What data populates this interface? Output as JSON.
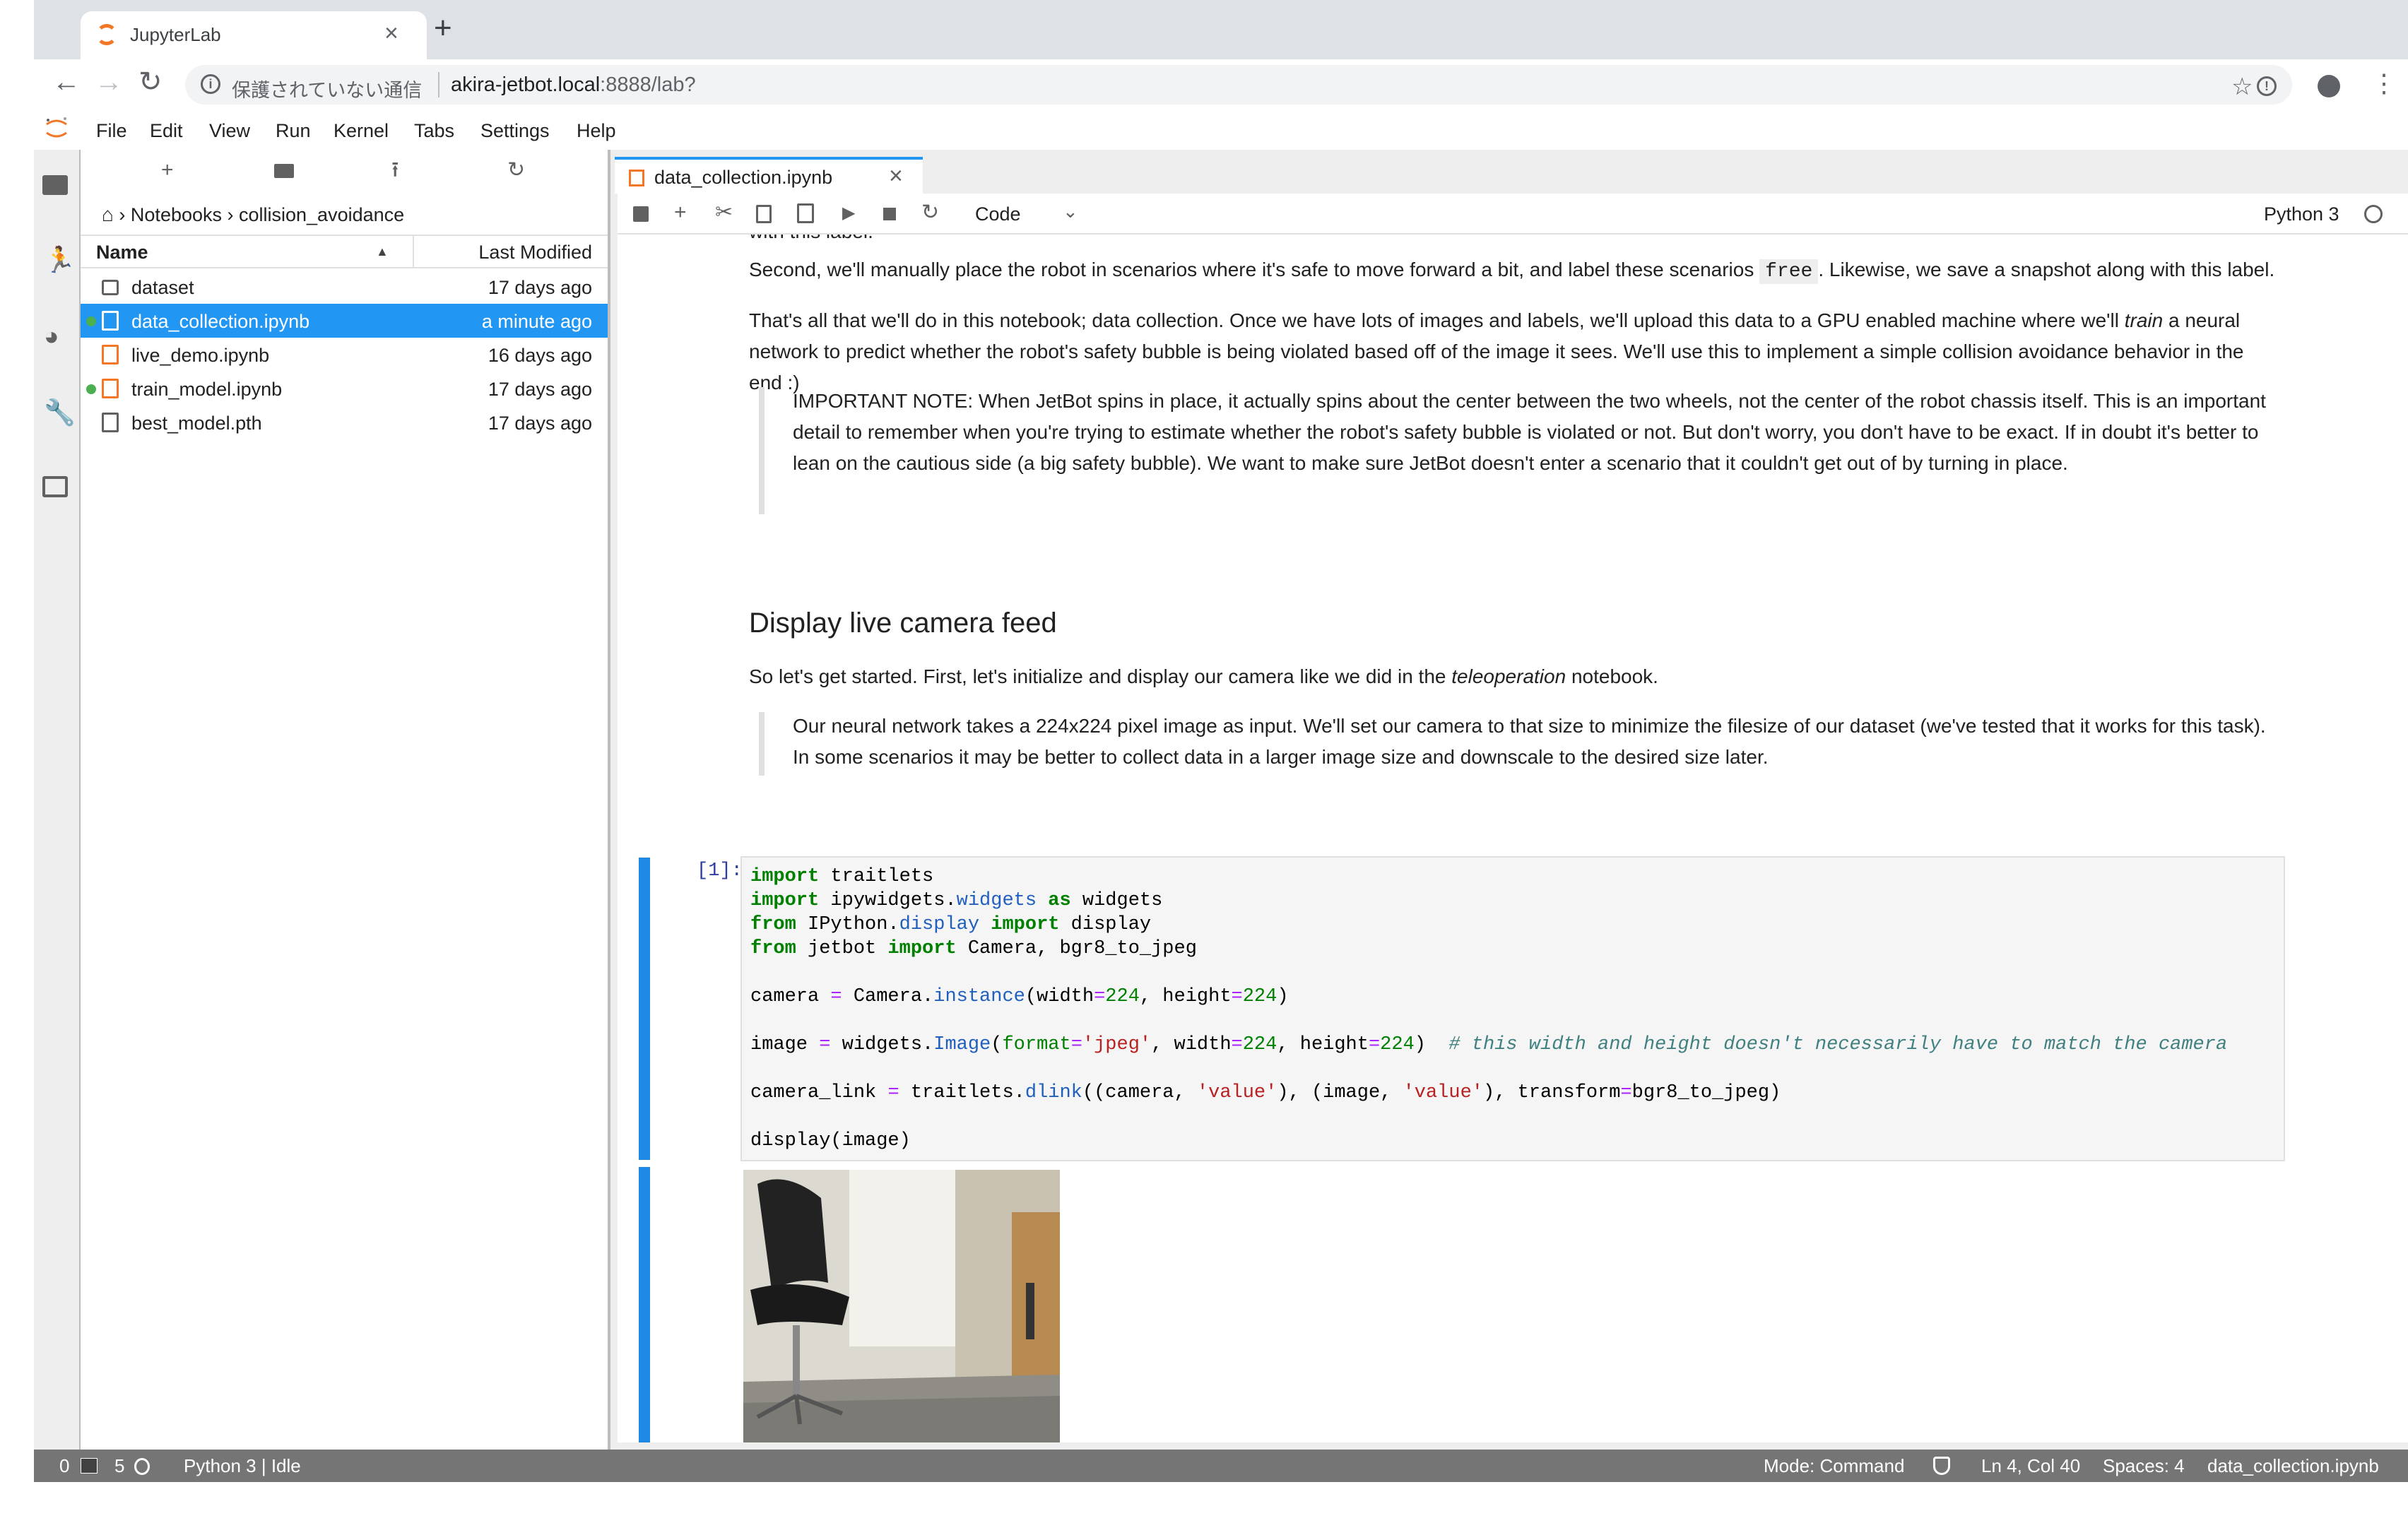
{
  "browser": {
    "tab_title": "JupyterLab",
    "security_text": "保護されていない通信",
    "url_host": "akira-jetbot.local",
    "url_path": ":8888/lab?"
  },
  "menubar": {
    "items": [
      "File",
      "Edit",
      "View",
      "Run",
      "Kernel",
      "Tabs",
      "Settings",
      "Help"
    ]
  },
  "filebrowser": {
    "breadcrumb": "Notebooks › collision_avoidance",
    "col_name": "Name",
    "col_modified": "Last Modified",
    "files": [
      {
        "name": "dataset",
        "modified": "17 days ago"
      },
      {
        "name": "data_collection.ipynb",
        "modified": "a minute ago"
      },
      {
        "name": "live_demo.ipynb",
        "modified": "16 days ago"
      },
      {
        "name": "train_model.ipynb",
        "modified": "17 days ago"
      },
      {
        "name": "best_model.pth",
        "modified": "17 days ago"
      }
    ]
  },
  "notebook": {
    "tab_title": "data_collection.ipynb",
    "cell_type": "Code",
    "kernel": "Python 3",
    "md": {
      "p0": "with this label.",
      "p1_a": "Second, we'll manually place the robot in scenarios where it's safe to move forward a bit, and label these scenarios ",
      "p1_code": "free",
      "p1_b": ". Likewise, we save a snapshot along with this label.",
      "p2_a": "That's all that we'll do in this notebook; data collection. Once we have lots of images and labels, we'll upload this data to a GPU enabled machine where we'll ",
      "p2_em": "train",
      "p2_b": " a neural network to predict whether the robot's safety bubble is being violated based off of the image it sees. We'll use this to implement a simple collision avoidance behavior in the end :)",
      "note1": "IMPORTANT NOTE: When JetBot spins in place, it actually spins about the center between the two wheels, not the center of the robot chassis itself. This is an important detail to remember when you're trying to estimate whether the robot's safety bubble is violated or not. But don't worry, you don't have to be exact. If in doubt it's better to lean on the cautious side (a big safety bubble). We want to make sure JetBot doesn't enter a scenario that it couldn't get out of by turning in place.",
      "h2": "Display live camera feed",
      "p3_a": "So let's get started. First, let's initialize and display our camera like we did in the ",
      "p3_em": "teleoperation",
      "p3_b": " notebook.",
      "note2": "Our neural network takes a 224x224 pixel image as input. We'll set our camera to that size to minimize the filesize of our dataset (we've tested that it works for this task). In some scenarios it may be better to collect data in a larger image size and downscale to the desired size later."
    },
    "cell_prompt": "[1]:",
    "code": {
      "l1_kw": "import",
      "l1": " traitlets",
      "l2_kw": "import",
      "l2_a": " ipywidgets.",
      "l2_attr": "widgets",
      "l2_kw2": " as",
      "l2_b": " widgets",
      "l3_kw": "from",
      "l3_a": " IPython.",
      "l3_attr": "display",
      "l3_kw2": " import",
      "l3_b": " display",
      "l4_kw": "from",
      "l4_a": " jetbot",
      "l4_kw2": " import",
      "l4_b": " Camera, bgr8_to_jpeg",
      "l5_a": "camera ",
      "l5_op": "=",
      "l5_b": " Camera.",
      "l5_attr": "instance",
      "l5_c": "(width",
      "l5_op2": "=",
      "l5_n1": "224",
      "l5_d": ", height",
      "l5_op3": "=",
      "l5_n2": "224",
      "l5_e": ")",
      "l6_a": "image ",
      "l6_op": "=",
      "l6_b": " widgets.",
      "l6_attr": "Image",
      "l6_c": "(",
      "l6_fmt": "format",
      "l6_op2": "=",
      "l6_s": "'jpeg'",
      "l6_d": ", width",
      "l6_op3": "=",
      "l6_n1": "224",
      "l6_e": ", height",
      "l6_op4": "=",
      "l6_n2": "224",
      "l6_f": ")  ",
      "l6_com": "# this width and height doesn't necessarily have to match the camera",
      "l7_a": "camera_link ",
      "l7_op": "=",
      "l7_b": " traitlets.",
      "l7_attr": "dlink",
      "l7_c": "((camera, ",
      "l7_s1": "'value'",
      "l7_d": "), (image, ",
      "l7_s2": "'value'",
      "l7_e": "), transform",
      "l7_op2": "=",
      "l7_f": "bgr8_to_jpeg)",
      "l8": "display(image)"
    }
  },
  "statusbar": {
    "terminals": "0",
    "kernels": "5",
    "kernel_status": "Python 3 | Idle",
    "mode": "Mode: Command",
    "position": "Ln 4, Col 40",
    "spaces": "Spaces: 4",
    "file": "data_collection.ipynb"
  },
  "colors": {
    "accent": "#2196f3",
    "jupyter_orange": "#f37726",
    "statusbar": "#757575"
  }
}
